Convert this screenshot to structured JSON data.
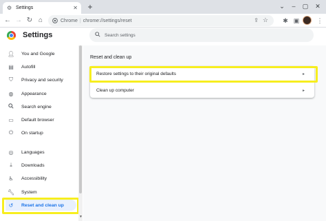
{
  "browser": {
    "tab_title": "Settings",
    "tab_icon": "gear-icon",
    "new_tab": "+",
    "site_label": "Chrome",
    "url_separator": "|",
    "url": "chrome://settings/reset",
    "window_controls": [
      "⌄",
      "–",
      "▢",
      "✕"
    ]
  },
  "header": {
    "title": "Settings",
    "search_placeholder": "Search settings"
  },
  "sidebar": {
    "items": [
      {
        "label": "You and Google",
        "icon": "person-icon"
      },
      {
        "label": "Autofill",
        "icon": "clipboard-icon"
      },
      {
        "label": "Privacy and security",
        "icon": "shield-icon"
      },
      {
        "label": "Appearance",
        "icon": "palette-icon"
      },
      {
        "label": "Search engine",
        "icon": "search-icon"
      },
      {
        "label": "Default browser",
        "icon": "browser-icon"
      },
      {
        "label": "On startup",
        "icon": "power-icon"
      },
      {
        "label": "Languages",
        "icon": "globe-icon"
      },
      {
        "label": "Downloads",
        "icon": "download-icon"
      },
      {
        "label": "Accessibility",
        "icon": "accessibility-icon"
      },
      {
        "label": "System",
        "icon": "wrench-icon"
      },
      {
        "label": "Reset and clean up",
        "icon": "history-icon",
        "active": true
      }
    ]
  },
  "main": {
    "section_title": "Reset and clean up",
    "rows": [
      {
        "label": "Restore settings to their original defaults"
      },
      {
        "label": "Clean up computer"
      }
    ]
  },
  "colors": {
    "accent": "#1a73e8",
    "highlight": "#f7ee1e"
  }
}
